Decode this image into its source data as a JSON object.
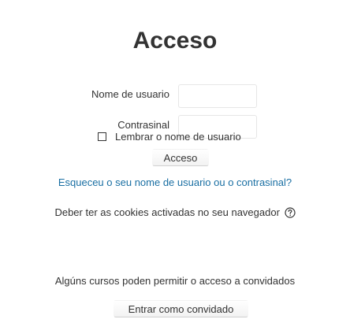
{
  "login": {
    "title": "Acceso",
    "username_label": "Nome de usuario",
    "username_value": "",
    "password_label": "Contrasinal",
    "password_value": "",
    "remember_label": "Lembrar o nome de usuario",
    "remember_checked": false,
    "submit_label": "Acceso",
    "forgot_link": "Esqueceu o seu nome de usuario ou o contrasinal?",
    "cookies_notice": "Deber ter as cookies activadas no seu navegador",
    "help_icon": "question-circle-icon"
  },
  "guest": {
    "notice": "Algúns cursos poden permitir o acceso a convidados",
    "button_label": "Entrar como convidado"
  },
  "colors": {
    "text": "#333333",
    "link": "#1a6fa3",
    "input_border": "#e6e6e6",
    "background": "#ffffff"
  }
}
